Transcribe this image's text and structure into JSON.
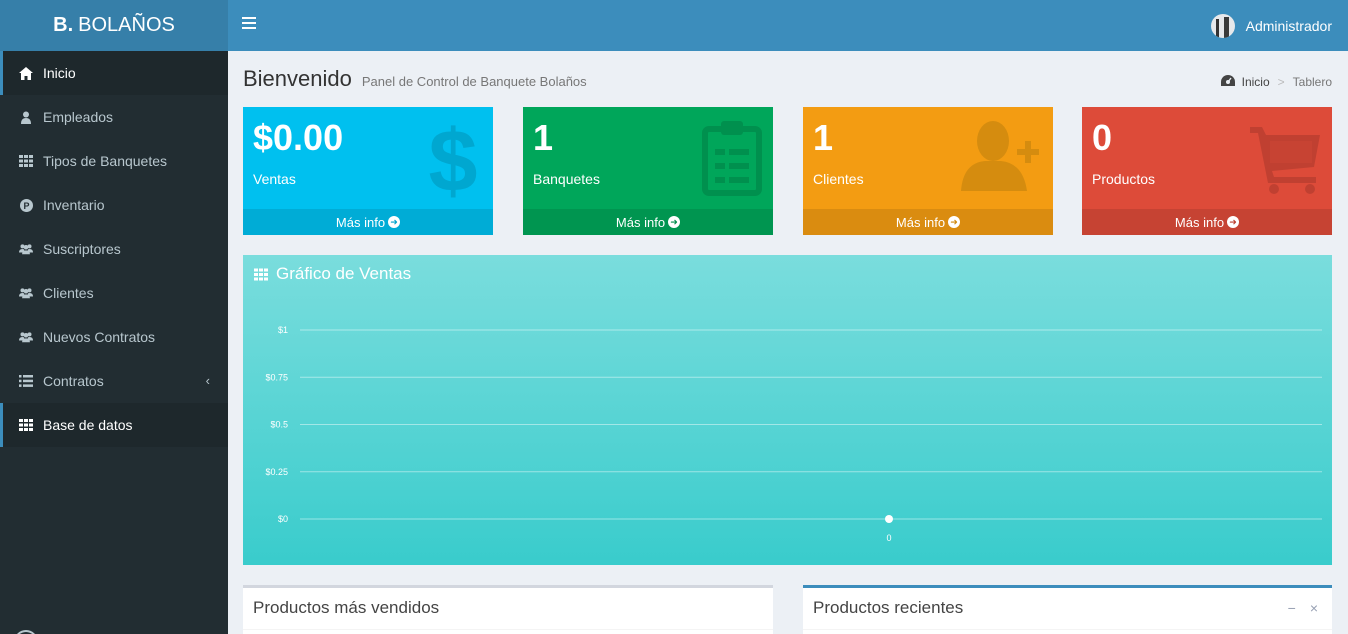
{
  "brand": {
    "bold": "B.",
    "text": "BOLAÑOS"
  },
  "header": {
    "user_name": "Administrador"
  },
  "sidebar": {
    "items": [
      {
        "label": "Inicio"
      },
      {
        "label": "Empleados"
      },
      {
        "label": "Tipos de Banquetes"
      },
      {
        "label": "Inventario"
      },
      {
        "label": "Suscriptores"
      },
      {
        "label": "Clientes"
      },
      {
        "label": "Nuevos Contratos"
      },
      {
        "label": "Contratos",
        "chevron": "‹"
      },
      {
        "label": "Base de datos"
      }
    ]
  },
  "page": {
    "title": "Bienvenido",
    "subtitle": "Panel de Control de Banquete Bolaños",
    "breadcrumb": {
      "home": "Inicio",
      "current": "Tablero"
    }
  },
  "stats": [
    {
      "value": "$0.00",
      "label": "Ventas",
      "more": "Más info",
      "color": "#00c0ef",
      "icon": "dollar-icon"
    },
    {
      "value": "1",
      "label": "Banquetes",
      "more": "Más info",
      "color": "#00a65a",
      "icon": "clipboard-icon"
    },
    {
      "value": "1",
      "label": "Clientes",
      "more": "Más info",
      "color": "#f39c12",
      "icon": "user-plus-icon"
    },
    {
      "value": "0",
      "label": "Productos",
      "more": "Más info",
      "color": "#dd4b39",
      "icon": "cart-icon"
    }
  ],
  "sales_chart": {
    "title": "Gráfico de Ventas"
  },
  "chart_data": {
    "type": "line",
    "title": "Gráfico de Ventas",
    "x": [
      "0"
    ],
    "series": [
      {
        "values": [
          0
        ]
      }
    ],
    "ylim": [
      0,
      1
    ],
    "yticks": [
      "$1",
      "$0.75",
      "$0.5",
      "$0.25",
      "$0"
    ],
    "grid": true
  },
  "panels": {
    "best_sellers": {
      "title": "Productos más vendidos"
    },
    "recent": {
      "title": "Productos recientes",
      "minimize": "−",
      "close": "×"
    }
  }
}
